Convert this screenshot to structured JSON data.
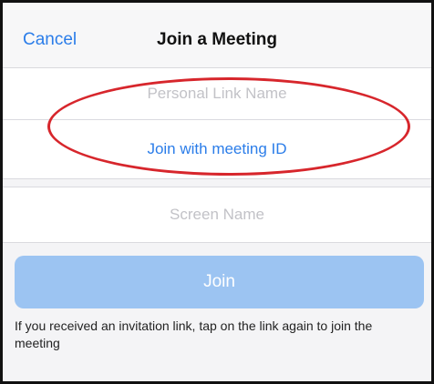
{
  "navbar": {
    "cancel_label": "Cancel",
    "title": "Join a Meeting"
  },
  "form": {
    "personal_link_placeholder": "Personal Link Name",
    "join_with_id_label": "Join with meeting ID",
    "screen_name_placeholder": "Screen Name"
  },
  "join_button_label": "Join",
  "hint_text": "If you received an invitation link, tap on the link again to join the meeting",
  "colors": {
    "accent": "#2b7de9",
    "join_button_disabled": "#9cc4f2",
    "annotation": "#d7262c"
  }
}
